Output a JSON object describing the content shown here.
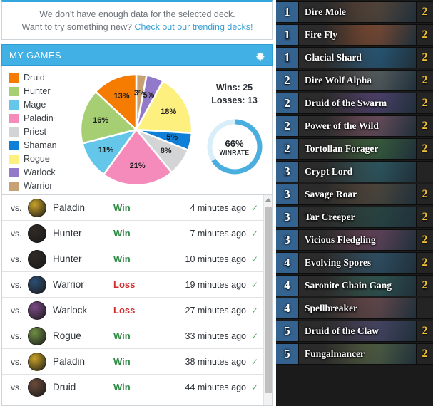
{
  "notice": {
    "line1": "We don't have enough data for the selected deck.",
    "line2_prefix": "Want to try something new? ",
    "link": "Check out our trending decks!"
  },
  "panel": {
    "title": "MY GAMES",
    "settings_icon": "gear-icon"
  },
  "chart_data": {
    "type": "pie",
    "title": "",
    "legend_position": "left",
    "categories": [
      "Druid",
      "Hunter",
      "Mage",
      "Paladin",
      "Priest",
      "Shaman",
      "Rogue",
      "Warlock",
      "Warrior"
    ],
    "values": [
      13,
      16,
      11,
      21,
      8,
      5,
      18,
      5,
      3
    ],
    "labels": [
      "13%",
      "16%",
      "11%",
      "21%",
      "8%",
      "5%",
      "18%",
      "5%",
      "3%"
    ],
    "colors": [
      "#f57c00",
      "#a5cf72",
      "#64c6e8",
      "#f48bbb",
      "#d2d4d6",
      "#0f7fd8",
      "#fdf07e",
      "#9279ca",
      "#c6a173"
    ],
    "unit": "%"
  },
  "winrate": {
    "wins_label": "Wins: 25",
    "losses_label": "Losses: 13",
    "percent": "66%",
    "sub": "WINRATE",
    "value": 66,
    "track_color": "#d8eef8",
    "fill_color": "#4aaede"
  },
  "games": {
    "vs_label": "vs.",
    "check_glyph": "✓",
    "rows": [
      {
        "opponent": "Paladin",
        "result": "Win",
        "result_kind": "win",
        "time": "4 minutes ago",
        "portrait": "#c9a227"
      },
      {
        "opponent": "Hunter",
        "result": "Win",
        "result_kind": "win",
        "time": "7 minutes ago",
        "portrait": "#2f2a26"
      },
      {
        "opponent": "Hunter",
        "result": "Win",
        "result_kind": "win",
        "time": "10 minutes ago",
        "portrait": "#2f2a26"
      },
      {
        "opponent": "Warrior",
        "result": "Loss",
        "result_kind": "loss",
        "time": "19 minutes ago",
        "portrait": "#2d4f75"
      },
      {
        "opponent": "Warlock",
        "result": "Loss",
        "result_kind": "loss",
        "time": "27 minutes ago",
        "portrait": "#7b4a86"
      },
      {
        "opponent": "Rogue",
        "result": "Win",
        "result_kind": "win",
        "time": "33 minutes ago",
        "portrait": "#6f8f45"
      },
      {
        "opponent": "Paladin",
        "result": "Win",
        "result_kind": "win",
        "time": "38 minutes ago",
        "portrait": "#c9a227"
      },
      {
        "opponent": "Druid",
        "result": "Win",
        "result_kind": "win",
        "time": "44 minutes ago",
        "portrait": "#6b4b3a"
      }
    ]
  },
  "deck": {
    "cards": [
      {
        "cost": "1",
        "name": "Dire Mole",
        "qty": "2",
        "art": "#8a5a3a"
      },
      {
        "cost": "1",
        "name": "Fire Fly",
        "qty": "2",
        "art": "#d4622a"
      },
      {
        "cost": "1",
        "name": "Glacial Shard",
        "qty": "2",
        "art": "#2f7fb5"
      },
      {
        "cost": "2",
        "name": "Dire Wolf Alpha",
        "qty": "2",
        "art": "#8e8c87"
      },
      {
        "cost": "2",
        "name": "Druid of the Swarm",
        "qty": "2",
        "art": "#7a4f9e"
      },
      {
        "cost": "2",
        "name": "Power of the Wild",
        "qty": "2",
        "art": "#b5697f"
      },
      {
        "cost": "2",
        "name": "Tortollan Forager",
        "qty": "2",
        "art": "#4f8a3d"
      },
      {
        "cost": "3",
        "name": "Crypt Lord",
        "qty": "",
        "art": "#3b7f86"
      },
      {
        "cost": "3",
        "name": "Savage Roar",
        "qty": "2",
        "art": "#7b5c3e"
      },
      {
        "cost": "3",
        "name": "Tar Creeper",
        "qty": "2",
        "art": "#2f5a4a"
      },
      {
        "cost": "3",
        "name": "Vicious Fledgling",
        "qty": "2",
        "art": "#a45478"
      },
      {
        "cost": "4",
        "name": "Evolving Spores",
        "qty": "2",
        "art": "#3d6f8e"
      },
      {
        "cost": "4",
        "name": "Saronite Chain Gang",
        "qty": "2",
        "art": "#3f7a66"
      },
      {
        "cost": "4",
        "name": "Spellbreaker",
        "qty": "",
        "art": "#a8605c"
      },
      {
        "cost": "5",
        "name": "Druid of the Claw",
        "qty": "2",
        "art": "#6d5a8e"
      },
      {
        "cost": "5",
        "name": "Fungalmancer",
        "qty": "2",
        "art": "#7d8a4a"
      }
    ]
  }
}
